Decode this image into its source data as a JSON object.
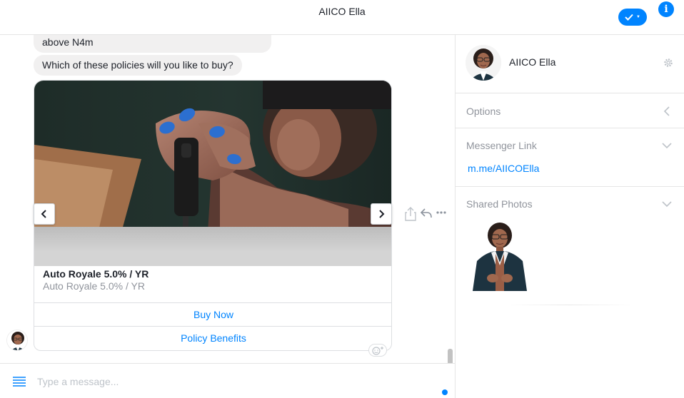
{
  "header": {
    "title": "AIICO Ella"
  },
  "chat": {
    "messages": [
      {
        "text": "above N4m"
      },
      {
        "text": "Which of these policies will you like to buy?"
      }
    ],
    "card": {
      "title": "Auto Royale 5.0% / YR",
      "subtitle": "Auto Royale 5.0% / YR",
      "buttons": [
        "Buy Now",
        "Policy Benefits"
      ]
    }
  },
  "composer": {
    "placeholder": "Type a message..."
  },
  "sidebar": {
    "profile_name": "AIICO Ella",
    "sections": {
      "options": "Options",
      "messenger_link": "Messenger Link",
      "messenger_link_url": "m.me/AIICOElla",
      "shared_photos": "Shared Photos"
    }
  },
  "colors": {
    "accent": "#0084ff",
    "bubble": "#f1f0f0",
    "muted": "#90949c",
    "border": "#dddfe2"
  }
}
